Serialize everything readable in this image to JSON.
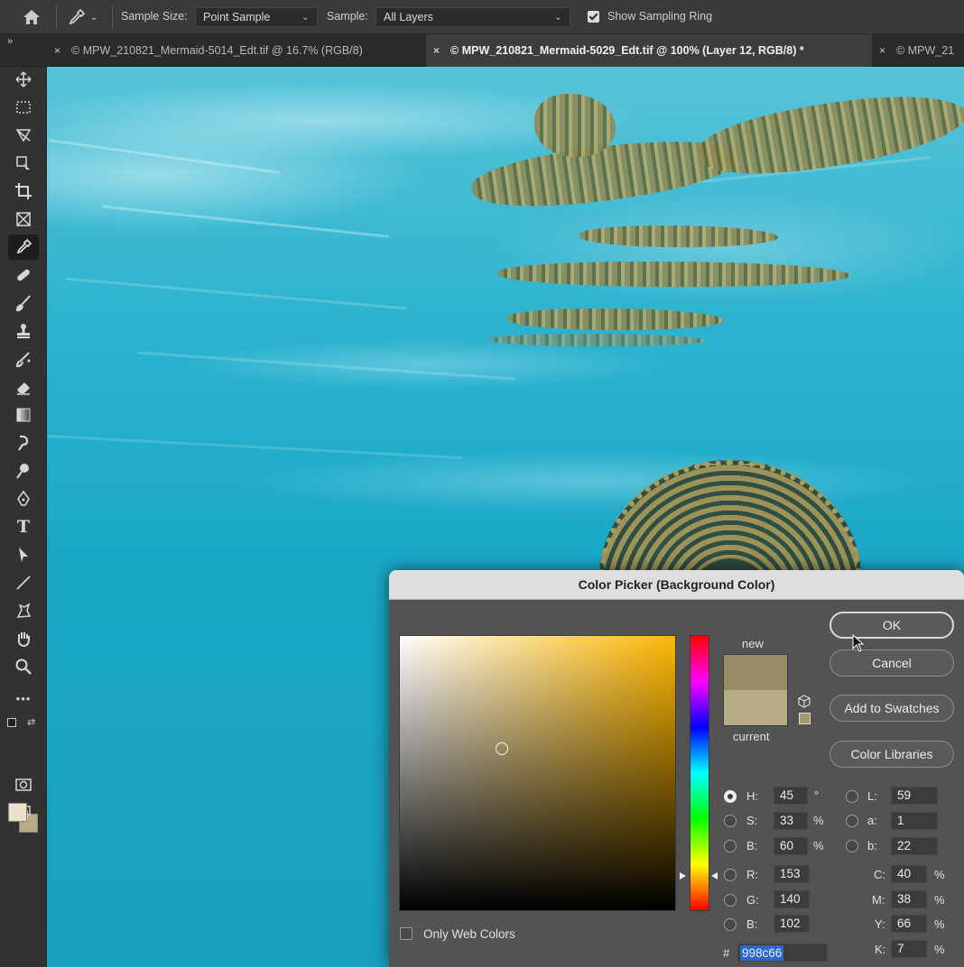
{
  "options_bar": {
    "sample_size_label": "Sample Size:",
    "sample_size_value": "Point Sample",
    "sample_label": "Sample:",
    "sample_value": "All Layers",
    "show_ring_label": "Show Sampling Ring",
    "show_ring_checked": true
  },
  "tabs": [
    {
      "label": "© MPW_210821_Mermaid-5014_Edt.tif @ 16.7% (RGB/8)",
      "active": false
    },
    {
      "label": "© MPW_210821_Mermaid-5029_Edt.tif @ 100% (Layer 12, RGB/8) *",
      "active": true
    },
    {
      "label": "© MPW_21",
      "active": false
    }
  ],
  "collapse_glyph": "»",
  "close_glyph": "×",
  "toolbar": {
    "tools": [
      "move-icon",
      "marquee-icon",
      "lasso-icon",
      "object-select-icon",
      "crop-icon",
      "frame-icon",
      "eyedropper-icon",
      "healing-icon",
      "brush-icon",
      "stamp-icon",
      "history-brush-icon",
      "eraser-icon",
      "gradient-icon",
      "smudge-icon",
      "dodge-icon",
      "pen-icon",
      "type-icon",
      "path-select-icon",
      "line-icon",
      "hand-rotate-icon",
      "hand-icon",
      "zoom-icon",
      "more-icon"
    ],
    "type_glyph": "T",
    "more_glyph": "•••",
    "foreground_color": "#ece1c8",
    "background_color": "#b7ab85"
  },
  "dialog": {
    "title": "Color Picker (Background Color)",
    "new_label": "new",
    "current_label": "current",
    "new_color": "#998c66",
    "current_color": "#b7ab85",
    "buttons": {
      "ok": "OK",
      "cancel": "Cancel",
      "add_swatches": "Add to Swatches",
      "libraries": "Color Libraries"
    },
    "hsb": {
      "h_label": "H:",
      "h": "45",
      "h_unit": "°",
      "s_label": "S:",
      "s": "33",
      "s_unit": "%",
      "b_label": "B:",
      "b": "60",
      "b_unit": "%"
    },
    "rgb": {
      "r_label": "R:",
      "r": "153",
      "g_label": "G:",
      "g": "140",
      "b_label": "B:",
      "b": "102"
    },
    "lab": {
      "l_label": "L:",
      "l": "59",
      "a_label": "a:",
      "a": "1",
      "b_label": "b:",
      "b": "22"
    },
    "cmyk": {
      "c_label": "C:",
      "c": "40",
      "m_label": "M:",
      "m": "38",
      "y_label": "Y:",
      "y": "66",
      "k_label": "K:",
      "k": "7",
      "unit": "%"
    },
    "hex_label": "#",
    "hex": "998c66",
    "only_web_colors_label": "Only Web Colors"
  }
}
